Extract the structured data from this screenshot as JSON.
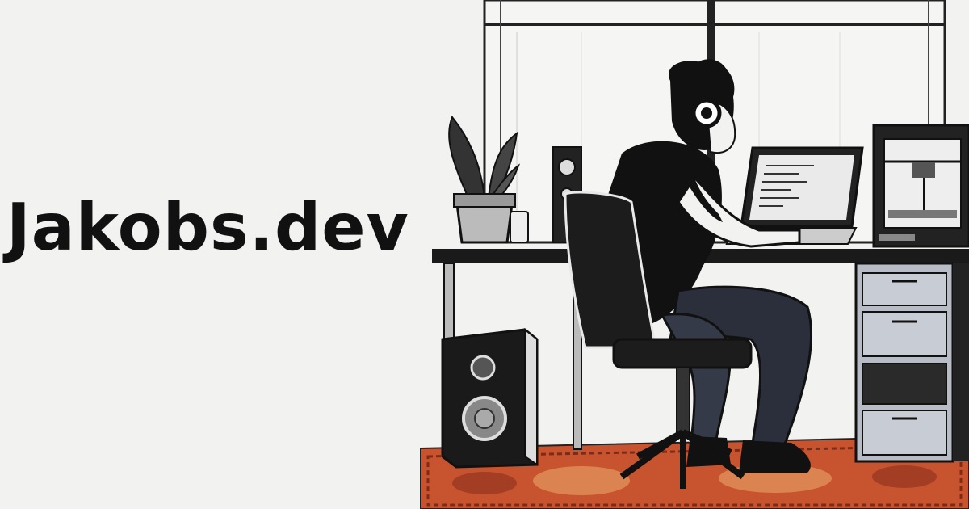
{
  "site": {
    "title": "Jakobs.dev"
  },
  "illustration": {
    "icon": "developer-at-desk-illustration",
    "rug_color": "#c8532f",
    "ink_color": "#111111",
    "wall_color": "#f2f2f0"
  }
}
